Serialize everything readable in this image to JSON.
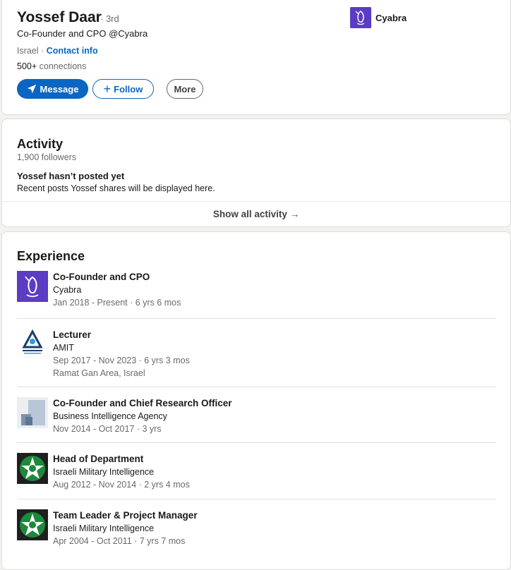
{
  "profile": {
    "name": "Yossef Daar",
    "degree": "· 3rd",
    "headline": "Co-Founder and CPO @Cyabra",
    "location": "Israel ·",
    "contact_info": "Contact info",
    "connections_count": "500+",
    "connections_label": "connections",
    "company": "Cyabra"
  },
  "actions": {
    "message": "Message",
    "follow": "Follow",
    "more": "More"
  },
  "activity": {
    "title": "Activity",
    "followers": "1,900 followers",
    "no_posts": "Yossef hasn’t posted yet",
    "note": "Recent posts Yossef shares will be displayed here.",
    "show_all": "Show all activity"
  },
  "experience": {
    "title": "Experience",
    "items": [
      {
        "role": "Co-Founder and CPO",
        "org": "Cyabra",
        "dates": "Jan 2018 - Present · 6 yrs 6 mos",
        "location": "",
        "logo": "cyabra-logo"
      },
      {
        "role": "Lecturer",
        "org": "AMIT",
        "dates": "Sep 2017 - Nov 2023 · 6 yrs 3 mos",
        "location": "Ramat Gan Area, Israel",
        "logo": "amit-logo"
      },
      {
        "role": "Co-Founder and Chief Research Officer",
        "org": "Business Intelligence Agency",
        "dates": "Nov 2014 - Oct 2017 · 3 yrs",
        "location": "",
        "logo": "bia-logo"
      },
      {
        "role": "Head of Department",
        "org": "Israeli Military Intelligence",
        "dates": "Aug 2012 - Nov 2014 · 2 yrs 4 mos",
        "location": "",
        "logo": "military-intelligence-logo"
      },
      {
        "role": "Team Leader & Project Manager",
        "org": "Israeli Military Intelligence",
        "dates": "Apr 2004 - Oct 2011 · 7 yrs 7 mos",
        "location": "",
        "logo": "military-intelligence-logo"
      }
    ]
  },
  "colors": {
    "primary": "#0a66c2",
    "cyabra": "#5b3cc4",
    "mi_green": "#1c8a3a"
  }
}
